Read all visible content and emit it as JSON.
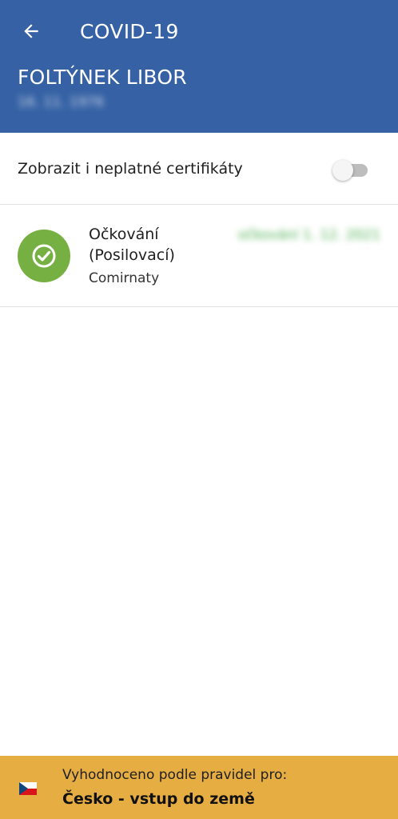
{
  "header": {
    "back_icon": "arrow-left-icon",
    "title": "COVID-19",
    "person_name": "FOLTÝNEK LIBOR",
    "birth_date": "16. 11. 1976",
    "background_color": "#3662a5"
  },
  "settings": {
    "show_invalid_label": "Zobrazit i neplatné certifikáty",
    "show_invalid_enabled": false
  },
  "certificates": [
    {
      "type": "Očkování (Posilovací)",
      "vaccine": "Comirnaty",
      "date": "očkování 1. 12. 2021",
      "status_icon": "check-circle-icon",
      "status_color": "#76b043"
    }
  ],
  "footer": {
    "caption": "Vyhodnoceno podle pravidel pro:",
    "rule": "Česko - vstup do země",
    "flag_icon": "czech-flag-icon",
    "background_color": "#e6ad42"
  }
}
